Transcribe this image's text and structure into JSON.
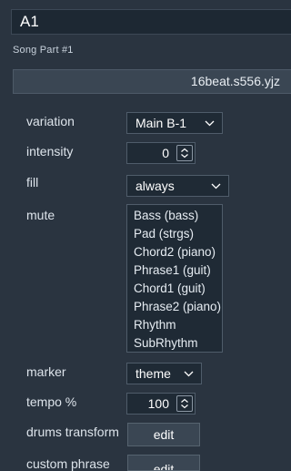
{
  "header": {
    "title": "A1",
    "subtitle": "Song Part #1"
  },
  "style_file": "16beat.s556.yjz",
  "fields": {
    "variation": {
      "label": "variation",
      "value": "Main B-1"
    },
    "intensity": {
      "label": "intensity",
      "value": "0"
    },
    "fill": {
      "label": "fill",
      "value": "always"
    },
    "mute": {
      "label": "mute",
      "options": [
        "Bass (bass)",
        "Pad (strgs)",
        "Chord2 (piano)",
        "Phrase1 (guit)",
        "Chord1 (guit)",
        "Phrase2 (piano)",
        "Rhythm",
        "SubRhythm"
      ]
    },
    "marker": {
      "label": "marker",
      "value": "theme"
    },
    "tempo": {
      "label": "tempo %",
      "value": "100"
    },
    "drums_transform": {
      "label": "drums transform",
      "button": "edit"
    },
    "custom_phrase": {
      "label": "custom phrase",
      "button": "edit"
    }
  },
  "icons": {
    "dropdown": "chevron-down-icon",
    "spinner": "updown-icon"
  },
  "colors": {
    "background": "#2a3440",
    "control": "#1f2a35",
    "border": "#4f5c6a",
    "text": "#ffffff"
  }
}
